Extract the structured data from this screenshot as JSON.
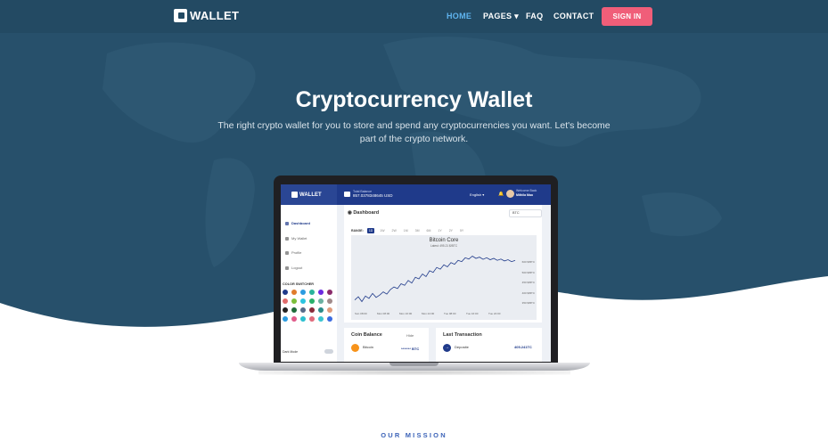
{
  "brand": {
    "name": "WALLET"
  },
  "nav": {
    "items": [
      {
        "label": "HOME",
        "active": true
      },
      {
        "label": "PAGES",
        "dropdown": true
      },
      {
        "label": "FAQ"
      },
      {
        "label": "CONTACT"
      }
    ],
    "signin_label": "SIGN IN"
  },
  "hero": {
    "title": "Cryptocurrency Wallet",
    "subtitle": "The right crypto wallet for you to store and spend any cryptocurrencies you want. Let's become part of the crypto network."
  },
  "app": {
    "brand": "WALLET",
    "total_balance_label": "Total Balance",
    "total_balance_value": "857.0378348645 USD",
    "language": "English",
    "welcome": "Welcome Back",
    "user_name": "Mithila Mao",
    "sidebar": {
      "items": [
        {
          "label": "Dashboard",
          "active": true
        },
        {
          "label": "My Wallet"
        },
        {
          "label": "Profile"
        },
        {
          "label": "Logout"
        }
      ],
      "color_switcher_label": "COLOR SWITCHER",
      "swatches": [
        "#1f3a8a",
        "#e07b2b",
        "#2b9be0",
        "#2bb39b",
        "#6b2be0",
        "#8a2b6b",
        "#e06b6b",
        "#7bbf3a",
        "#2bc4e0",
        "#2bb06b",
        "#6bb0a0",
        "#a08a8a",
        "#222222",
        "#1f6b3a",
        "#556b8a",
        "#8a2b3a",
        "#2b8a8a",
        "#e09b7b",
        "#2b9be0",
        "#e05b8a",
        "#2bbfd0",
        "#e06b7b",
        "#3ac4d0",
        "#3a6be0"
      ],
      "dark_mode_label": "Dark Mode"
    },
    "dashboard": {
      "title": "Dashboard",
      "currency_select": "BTC",
      "range_label": "RANGE:",
      "ranges": [
        "1D",
        "1W",
        "2W",
        "1M",
        "3M",
        "6M",
        "1Y",
        "2Y",
        "5Y"
      ],
      "active_range": "1D"
    },
    "chart_data": {
      "type": "line",
      "title": "Bitcoin Core",
      "subtitle": "Latest: 495.21 $/BTC",
      "x": [
        "Sun 08:00",
        "Mon 08:00",
        "Mon 16:00",
        "Mon 24:00",
        "Tue 08:00",
        "Tue 16:00",
        "Tue 24:00"
      ],
      "yticks": [
        "600 $/BTC",
        "500 $/BTC",
        "450 $/BTC",
        "400 $/BTC",
        "350 $/BTC"
      ],
      "values": [
        360,
        370,
        355,
        372,
        365,
        380,
        368,
        375,
        385,
        378,
        392,
        400,
        395,
        410,
        405,
        420,
        412,
        430,
        425,
        440,
        432,
        450,
        445,
        460,
        455,
        468,
        462,
        475,
        470,
        482,
        478,
        490,
        486,
        495,
        488,
        492,
        485,
        490,
        484,
        488,
        482,
        486,
        480,
        484,
        478,
        482
      ]
    },
    "coin_balance": {
      "title": "Coin Balance",
      "hide_label": "Hide",
      "coin": "Bitcoin",
      "masked": "******* BTC"
    },
    "last_transaction": {
      "title": "Last Transaction",
      "type": "Deposite",
      "amount": "405.241TC"
    }
  },
  "mission": {
    "label": "OUR MISSION"
  }
}
